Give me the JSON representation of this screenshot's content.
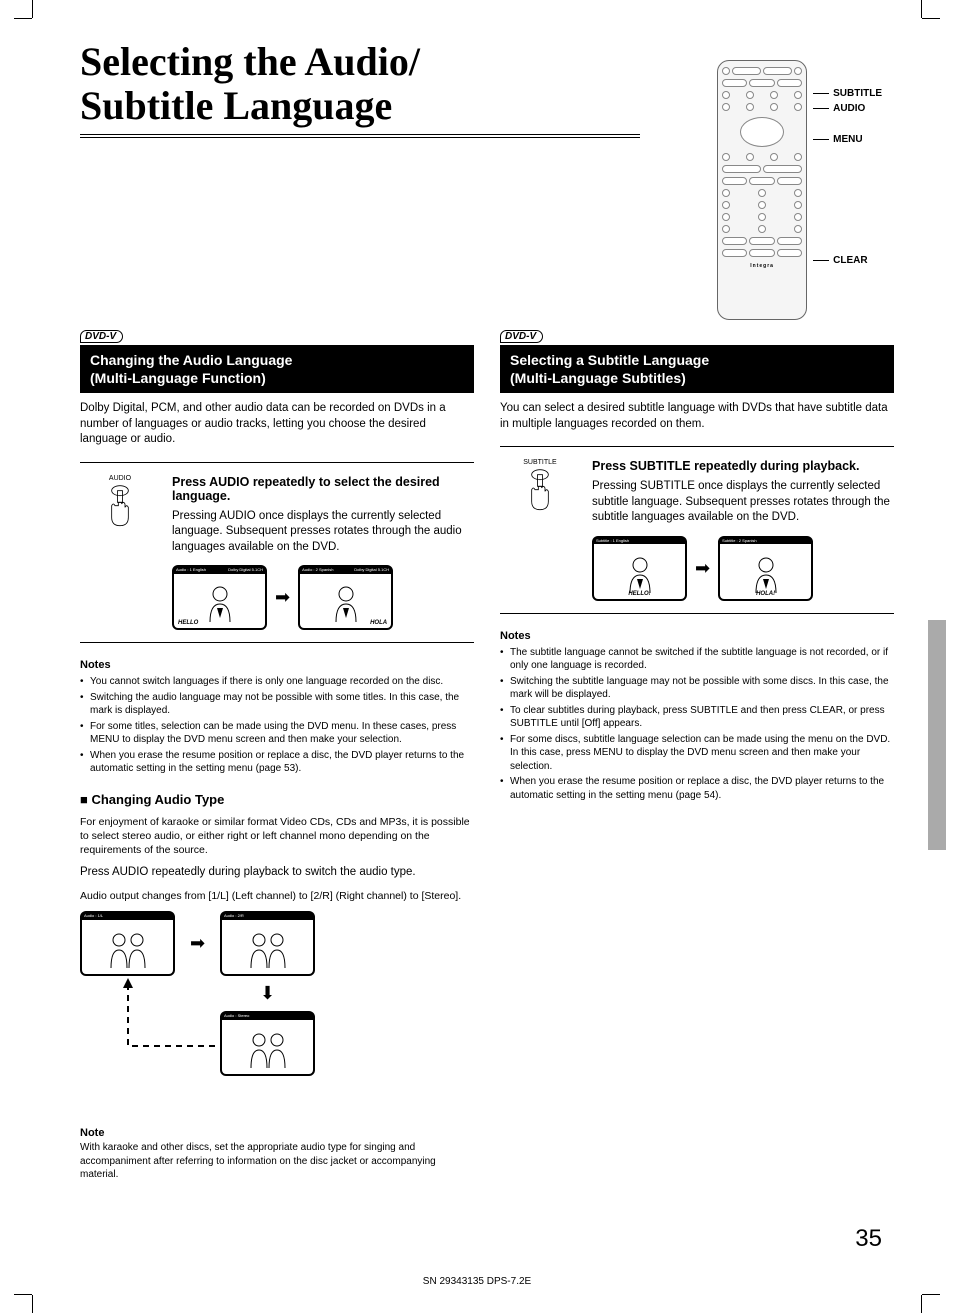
{
  "page_title_line1": "Selecting the Audio/",
  "page_title_line2": "Subtitle Language",
  "remote_labels": {
    "subtitle": "SUBTITLE",
    "audio": "AUDIO",
    "menu": "MENU",
    "clear": "CLEAR"
  },
  "remote_brand": "Integra",
  "dvd_v_badge": "DVD-V",
  "left": {
    "header_line1": "Changing the Audio Language",
    "header_line2": "(Multi-Language Function)",
    "intro": "Dolby Digital, PCM, and other audio data can be recorded on DVDs in a number of languages or audio tracks, letting you choose the desired language or audio.",
    "press_btn_label": "AUDIO",
    "instr_title": "Press AUDIO repeatedly to select the desired language.",
    "instr_body": "Pressing AUDIO once displays the currently selected language. Subsequent presses rotates through the audio languages available on the DVD.",
    "tv1_bar_left": "Audio    : 1  English",
    "tv1_bar_right": "Dolby Digital\n5.1CH",
    "tv1_caption": "HELLO",
    "tv2_bar_left": "Audio    : 2  Spanish",
    "tv2_bar_right": "Dolby Digital\n5.1CH",
    "tv2_caption": "HOLA",
    "notes_title": "Notes",
    "notes": [
      "You cannot switch languages if there is only one language recorded on the disc.",
      "Switching the audio language may not be possible with some titles. In this case, the  mark is displayed.",
      "For some titles, selection can be made using the DVD menu. In these cases, press MENU to display the DVD menu screen and then make your selection.",
      "When you erase the resume position or replace a disc, the DVD player returns to the automatic setting in the setting menu (page 53)."
    ],
    "sub_heading": "Changing Audio Type",
    "sub_body1": "For enjoyment of karaoke or similar format Video CDs, CDs and MP3s, it is possible to select stereo audio, or either right or left channel mono depending on the requirements of the source.",
    "sub_body2": "Press AUDIO repeatedly during playback to switch the audio type.",
    "sub_body3": "Audio output changes from [1/L] (Left channel) to [2/R] (Right channel) to [Stereo].",
    "cycle_tv1_bar": "Audio    : 1/L",
    "cycle_tv2_bar": "Audio    : 2/R",
    "cycle_tv3_bar": "Audio    : Stereo",
    "note2_title": "Note",
    "note2_body": "With karaoke and other discs, set the appropriate audio type for singing and accompaniment after referring to information on the disc jacket or accompanying material."
  },
  "right": {
    "header_line1": "Selecting a Subtitle Language",
    "header_line2": "(Multi-Language Subtitles)",
    "intro": "You can select a desired subtitle language with DVDs that have subtitle data in multiple languages recorded on them.",
    "press_btn_label": "SUBTITLE",
    "instr_title": "Press SUBTITLE repeatedly during playback.",
    "instr_body": "Pressing SUBTITLE once displays the currently selected subtitle language. Subsequent presses rotates through the subtitle languages available on the DVD.",
    "tv1_bar": "Subtitle : 1  English",
    "tv1_caption": "HELLO!",
    "tv2_bar": "Subtitle : 2  Spanish",
    "tv2_caption": "HOLA!",
    "notes_title": "Notes",
    "notes": [
      "The subtitle language cannot be switched if the subtitle language is not recorded, or if only one language is recorded.",
      "Switching the subtitle language may not be possible with some discs. In this case, the  mark will be displayed.",
      "To clear subtitles during playback, press SUBTITLE and then press CLEAR, or press SUBTITLE until [Off] appears.",
      "For some discs, subtitle language selection can be made using the menu on the DVD. In this case, press MENU to display the DVD menu screen and then make your selection.",
      "When you erase the resume position or replace a disc, the DVD player returns to the automatic setting in the setting menu (page 54)."
    ]
  },
  "page_number": "35",
  "footer_code": "SN 29343135 DPS-7.2E"
}
